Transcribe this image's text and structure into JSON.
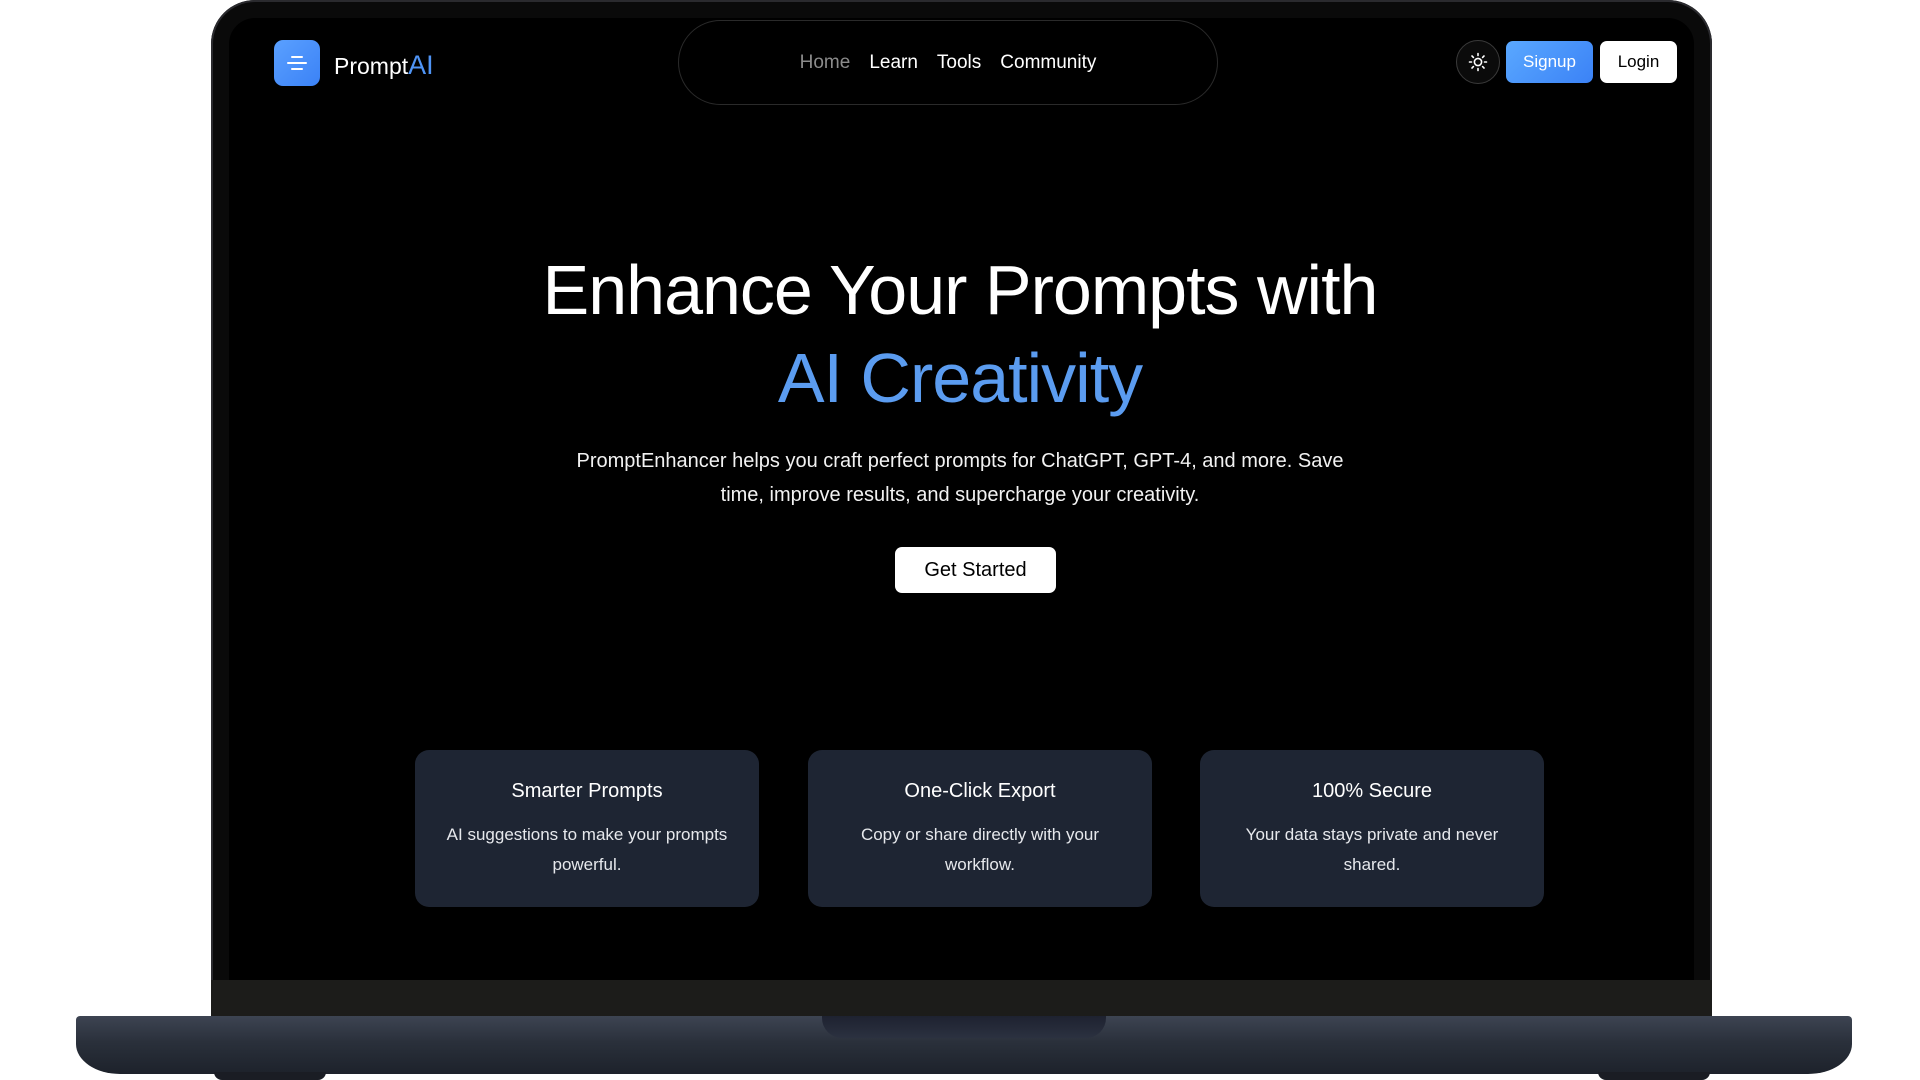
{
  "brand": {
    "name": "Prompt",
    "suffix": "AI",
    "accent": "#4f94f5"
  },
  "nav": {
    "links": [
      {
        "label": "Home",
        "active": false
      },
      {
        "label": "Learn",
        "active": true
      },
      {
        "label": "Tools",
        "active": true
      },
      {
        "label": "Community",
        "active": true
      }
    ],
    "theme_toggle_icon": "sun-icon",
    "menu_icon": "menu-icon",
    "signup_label": "Signup",
    "login_label": "Login"
  },
  "hero": {
    "title_line1": "Enhance Your Prompts with",
    "title_line2": "AI Creativity",
    "title_accent_color": "#5b9cf0",
    "description": "PromptEnhancer helps you craft perfect prompts for ChatGPT, GPT-4, and more. Save time, improve results, and supercharge your creativity.",
    "cta_label": "Get Started"
  },
  "features": [
    {
      "title": "Smarter Prompts",
      "text": "AI suggestions to make your prompts powerful."
    },
    {
      "title": "One-Click Export",
      "text": "Copy or share directly with your workflow."
    },
    {
      "title": "100% Secure",
      "text": "Your data stays private and never shared."
    }
  ],
  "colors": {
    "background": "#000000",
    "card": "#1e2533",
    "primary": "#3b82f6"
  }
}
